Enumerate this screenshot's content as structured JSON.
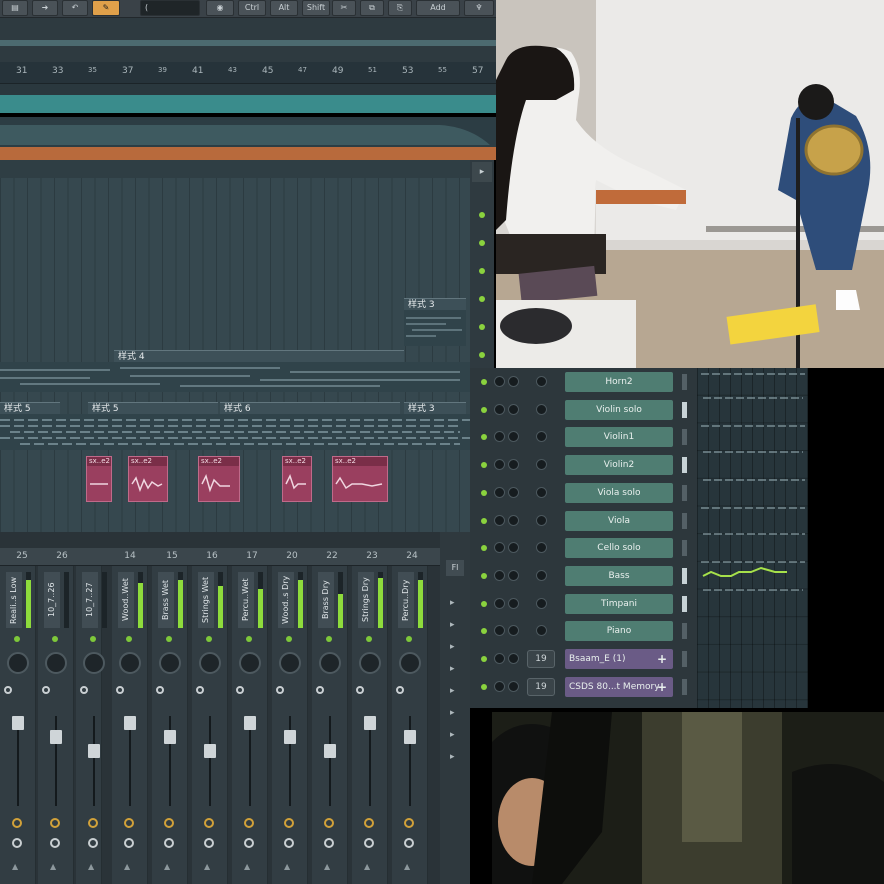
{
  "toolbar": {
    "buttons": [
      "Ctrl",
      "Alt",
      "Shift",
      "Add"
    ],
    "snap_field": "("
  },
  "ruler": {
    "ticks": [
      "31",
      "33",
      "35",
      "37",
      "39",
      "41",
      "43",
      "45",
      "47",
      "49",
      "51",
      "53",
      "55",
      "57"
    ]
  },
  "playlist": {
    "pattern_labels": {
      "p1": "样式 3",
      "p2": "样式 4",
      "p3": "样式 5",
      "p4": "样式 5",
      "p5": "样式 6",
      "p6": "样式 3"
    },
    "clips": [
      "sx..e2",
      "sx..e2",
      "sx..e2",
      "sx..e2",
      "sx..e2"
    ]
  },
  "mixer": {
    "track_numbers": [
      "25",
      "26",
      "14",
      "15",
      "16",
      "17",
      "20",
      "22",
      "23",
      "24"
    ],
    "strips": [
      {
        "name": "Reali..s Low",
        "meter": 0.85
      },
      {
        "name": "10_7..26",
        "meter": 0.0
      },
      {
        "name": "10_7..27",
        "meter": 0.0
      },
      {
        "name": "Wood..Wet",
        "meter": 0.8
      },
      {
        "name": "Brass Wet",
        "meter": 0.85
      },
      {
        "name": "Strings Wet",
        "meter": 0.75
      },
      {
        "name": "Percu..Wet",
        "meter": 0.7
      },
      {
        "name": "Wood..s Dry",
        "meter": 0.85
      },
      {
        "name": "Brass Dry",
        "meter": 0.6
      },
      {
        "name": "Strings Dry",
        "meter": 0.9
      },
      {
        "name": "Percu..Dry",
        "meter": 0.85
      }
    ],
    "side_label": "Fl"
  },
  "channel_rack": {
    "channels": [
      {
        "name": "Horn2",
        "type": "instrument"
      },
      {
        "name": "Violin solo",
        "type": "instrument"
      },
      {
        "name": "Violin1",
        "type": "instrument"
      },
      {
        "name": "Violin2",
        "type": "instrument"
      },
      {
        "name": "Viola solo",
        "type": "instrument"
      },
      {
        "name": "Viola",
        "type": "instrument"
      },
      {
        "name": "Cello solo",
        "type": "instrument"
      },
      {
        "name": "Bass",
        "type": "instrument"
      },
      {
        "name": "Timpani",
        "type": "instrument"
      },
      {
        "name": "Piano",
        "type": "instrument"
      },
      {
        "name": "Bsaam_E (1)",
        "type": "plugin",
        "mixer_track": "19"
      },
      {
        "name": "CSDS 80...t Memory",
        "type": "plugin",
        "mixer_track": "19"
      }
    ]
  },
  "colors": {
    "teal_band": "#3a8c8c",
    "orange_bar": "#b86a3c",
    "clip_pink": "#9a3f5f",
    "channel_green": "#4f7d72",
    "channel_purple": "#6a5b86",
    "meter_green": "#8edb3c"
  },
  "icons": [
    "record-icon",
    "cut-icon",
    "copy-icon",
    "paste-icon",
    "snap-icon",
    "magnet-icon",
    "add-icon"
  ]
}
